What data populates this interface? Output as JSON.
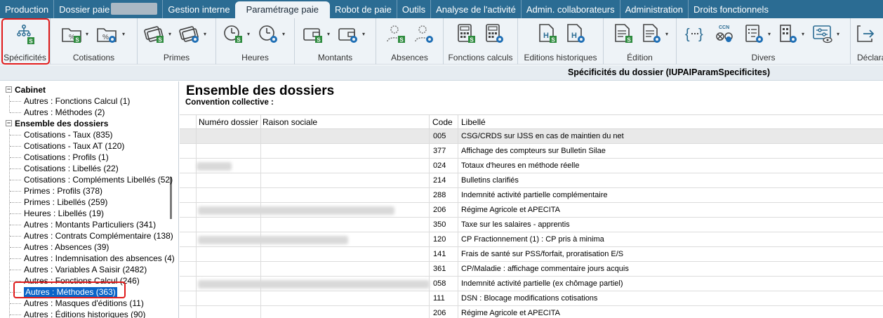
{
  "menu": {
    "items": [
      {
        "label": "Production"
      },
      {
        "label": "Dossier paie"
      },
      {
        "label": "Gestion interne"
      },
      {
        "label": "Paramétrage paie"
      },
      {
        "label": "Robot de paie"
      },
      {
        "label": "Outils"
      },
      {
        "label": "Analyse de l'activité"
      },
      {
        "label": "Admin. collaborateurs"
      },
      {
        "label": "Administration"
      },
      {
        "label": "Droits fonctionnels"
      }
    ]
  },
  "ribbon": {
    "groups": [
      {
        "label": "Spécificités"
      },
      {
        "label": "Cotisations"
      },
      {
        "label": "Primes"
      },
      {
        "label": "Heures"
      },
      {
        "label": "Montants"
      },
      {
        "label": "Absences"
      },
      {
        "label": "Fonctions calculs"
      },
      {
        "label": "Editions historiques"
      },
      {
        "label": "Édition"
      },
      {
        "label": "Divers"
      },
      {
        "label": "Déclara"
      }
    ],
    "ccn_badge": "CCN",
    "accent_color": "#2b6c93",
    "highlight_color": "#e01b1b"
  },
  "titlebar": {
    "text": "Spécificités du dossier (IUPAIParamSpecificites)"
  },
  "tree": {
    "items": [
      {
        "label": "Cabinet"
      },
      {
        "label": "Autres : Fonctions Calcul (1)"
      },
      {
        "label": "Autres : Méthodes (2)"
      },
      {
        "label": "Ensemble des dossiers"
      },
      {
        "label": "Cotisations - Taux (835)"
      },
      {
        "label": "Cotisations - Taux AT (120)"
      },
      {
        "label": "Cotisations : Profils (1)"
      },
      {
        "label": "Cotisations : Libellés (22)"
      },
      {
        "label": "Cotisations : Compléments Libellés (52)"
      },
      {
        "label": "Primes : Profils (378)"
      },
      {
        "label": "Primes : Libellés (259)"
      },
      {
        "label": "Heures : Libellés (19)"
      },
      {
        "label": "Autres : Montants Particuliers (341)"
      },
      {
        "label": "Autres : Contrats Complémentaire (138)"
      },
      {
        "label": "Autres : Absences (39)"
      },
      {
        "label": "Autres : Indemnisation des absences (4)"
      },
      {
        "label": "Autres : Variables A Saisir (2482)"
      },
      {
        "label": "Autres : Fonctions Calcul (246)"
      },
      {
        "label": "Autres : Méthodes (363)"
      },
      {
        "label": "Autres : Masques d'éditions (11)"
      },
      {
        "label": "Autres : Éditions historiques (90)"
      }
    ],
    "selected_label": "Autres : Méthodes (363)"
  },
  "main": {
    "title": "Ensemble des dossiers",
    "subtitle": "Convention collective :",
    "columns": {
      "numero": "Numéro dossier",
      "raison": "Raison sociale",
      "code": "Code",
      "libelle": "Libellé"
    },
    "rows": [
      {
        "code": "005",
        "libelle": "CSG/CRDS sur IJSS en cas de maintien du net"
      },
      {
        "code": "377",
        "libelle": "Affichage des compteurs sur Bulletin Silae"
      },
      {
        "code": "024",
        "libelle": "Totaux d'heures en méthode réelle"
      },
      {
        "code": "214",
        "libelle": "Bulletins clarifiés"
      },
      {
        "code": "288",
        "libelle": "Indemnité activité partielle complémentaire"
      },
      {
        "code": "206",
        "libelle": "Régime Agricole et APECITA"
      },
      {
        "code": "350",
        "libelle": "Taxe sur les salaires - apprentis"
      },
      {
        "code": "120",
        "libelle": "CP Fractionnement (1) : CP pris à minima"
      },
      {
        "code": "141",
        "libelle": "Frais de santé sur PSS/forfait, proratisation E/S"
      },
      {
        "code": "361",
        "libelle": "CP/Maladie : affichage commentaire jours acquis"
      },
      {
        "code": "058",
        "libelle": "Indemnité activité partielle (ex chômage partiel)"
      },
      {
        "code": "111",
        "libelle": "DSN : Blocage modifications cotisations"
      },
      {
        "code": "206",
        "libelle": "Régime Agricole et APECITA"
      }
    ]
  }
}
